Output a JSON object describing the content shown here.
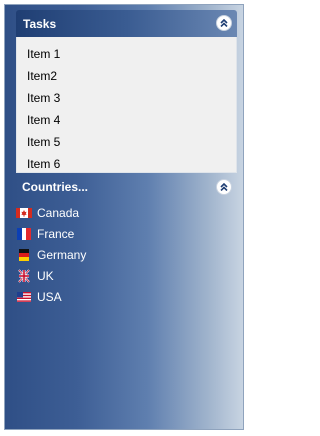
{
  "tasks": {
    "title": "Tasks",
    "items": [
      "Item 1",
      "Item2",
      "Item 3",
      "Item 4",
      "Item 5",
      "Item 6"
    ]
  },
  "countries": {
    "title": "Countries...",
    "items": [
      {
        "label": "Canada",
        "icon": "canada-flag-icon"
      },
      {
        "label": "France",
        "icon": "france-flag-icon"
      },
      {
        "label": "Germany",
        "icon": "germany-flag-icon"
      },
      {
        "label": "UK",
        "icon": "uk-flag-icon"
      },
      {
        "label": "USA",
        "icon": "usa-flag-icon"
      }
    ]
  },
  "colors": {
    "panel_dark": "#2f4f86",
    "panel_light": "#c8d4e2",
    "task_body": "#f0f0f0",
    "header_text": "#ffffff"
  }
}
